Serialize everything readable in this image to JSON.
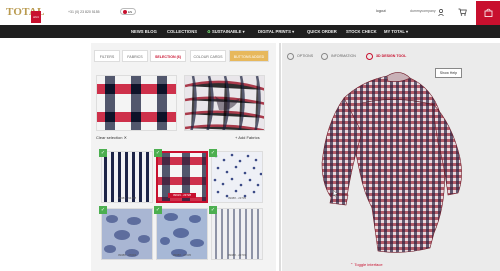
{
  "header": {
    "logo_text": "TOTAL",
    "logo_badge": "shirt",
    "phone": "+31 (0) 23 820 5155",
    "toggle_label": "EN",
    "logout_label": "logout",
    "company_label": "dummycompany",
    "brand_color": "#c8102e"
  },
  "nav": {
    "items": [
      {
        "label": "NEWS BLOG"
      },
      {
        "label": "COLLECTIONS"
      },
      {
        "label": "SUSTAINABLE",
        "prefix": "♻",
        "suffix": "▾"
      },
      {
        "label": "DIGITAL PRINTS",
        "suffix": "▾"
      },
      {
        "label": "QUICK ORDER"
      },
      {
        "label": "STOCK CHECK"
      },
      {
        "label": "MY TOTAL",
        "suffix": "▾"
      }
    ]
  },
  "left": {
    "tabs": [
      {
        "label": "FILTERS"
      },
      {
        "label": "FABRICS"
      },
      {
        "label": "SELECTION (6)"
      },
      {
        "label": "COLOUR CARDS"
      },
      {
        "label": "BUTTONS ADDED"
      }
    ],
    "clear_selection": "Clear selection ✕",
    "add_fabrics": "+ Add Fabrics",
    "tiles": [
      {
        "code": "09087 - 94178"
      },
      {
        "code": "09919 - 23728"
      },
      {
        "code": "09088 - 23735"
      },
      {
        "code": "09088 - 27004"
      },
      {
        "code": "09088 - 27005"
      },
      {
        "code": "09088 - 23703"
      }
    ]
  },
  "right": {
    "tabs": [
      {
        "label": "OPTIONS"
      },
      {
        "label": "INFORMATION"
      },
      {
        "label": "3D DESIGN TOOL"
      }
    ],
    "show_help": "Show Help",
    "toggle_interface": "⌃ Toggle interface"
  }
}
